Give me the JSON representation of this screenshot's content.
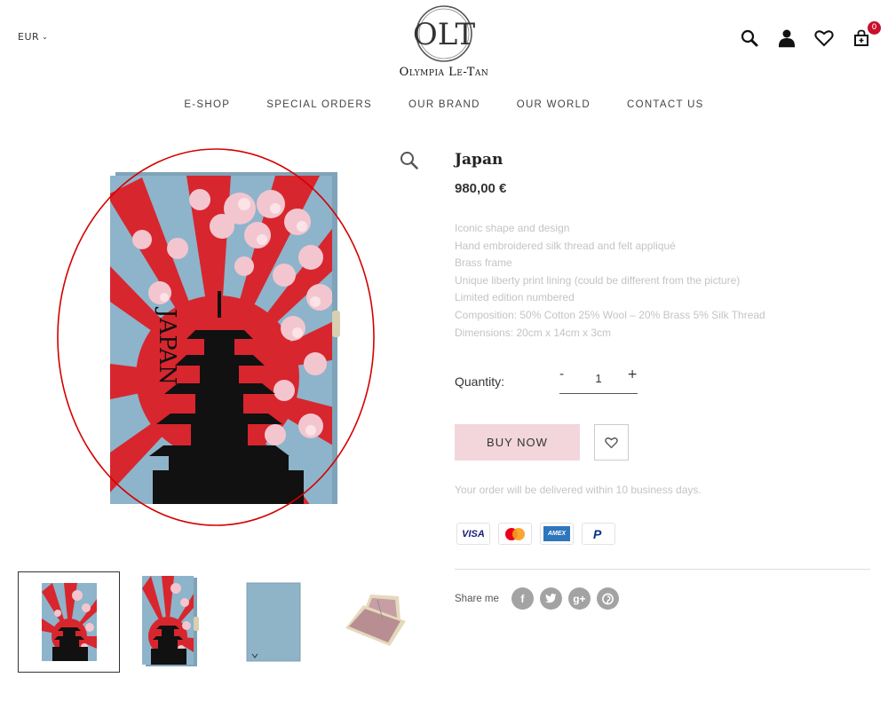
{
  "header": {
    "currency": "EUR",
    "brand": "Olympia Le-Tan",
    "logo_monogram": "OLT",
    "cart_count": "0"
  },
  "nav": [
    "E-SHOP",
    "SPECIAL ORDERS",
    "OUR BRAND",
    "OUR WORLD",
    "CONTACT US"
  ],
  "product": {
    "title": "Japan",
    "price": "980,00 €",
    "image_text": "JAPAN",
    "description": [
      "Iconic shape and design",
      "Hand embroidered silk thread and felt appliqué",
      "Brass frame",
      "Unique liberty print lining (could be different from the picture)",
      "Limited edition numbered",
      "Composition: 50% Cotton 25% Wool – 20% Brass 5% Silk Thread",
      "Dimensions: 20cm x 14cm x 3cm"
    ],
    "quantity_label": "Quantity:",
    "quantity_value": "1",
    "minus": "-",
    "plus": "+",
    "buy_label": "BUY NOW",
    "delivery": "Your order will be delivered within 10 business days."
  },
  "payments": [
    "VISA",
    "Mastercard",
    "AMEX",
    "PayPal"
  ],
  "payment_text": {
    "visa": "VISA",
    "amex": "AMEX",
    "paypal": "P"
  },
  "share": {
    "label": "Share me",
    "networks": [
      "facebook",
      "twitter",
      "google-plus",
      "pinterest"
    ],
    "glyphs": {
      "facebook": "f",
      "google_plus": "g+"
    }
  },
  "colors": {
    "accent_red": "#c8102e",
    "buy_button": "#f2d6dc",
    "book_blue": "#86aec4",
    "annotation_circle": "#d40000"
  }
}
